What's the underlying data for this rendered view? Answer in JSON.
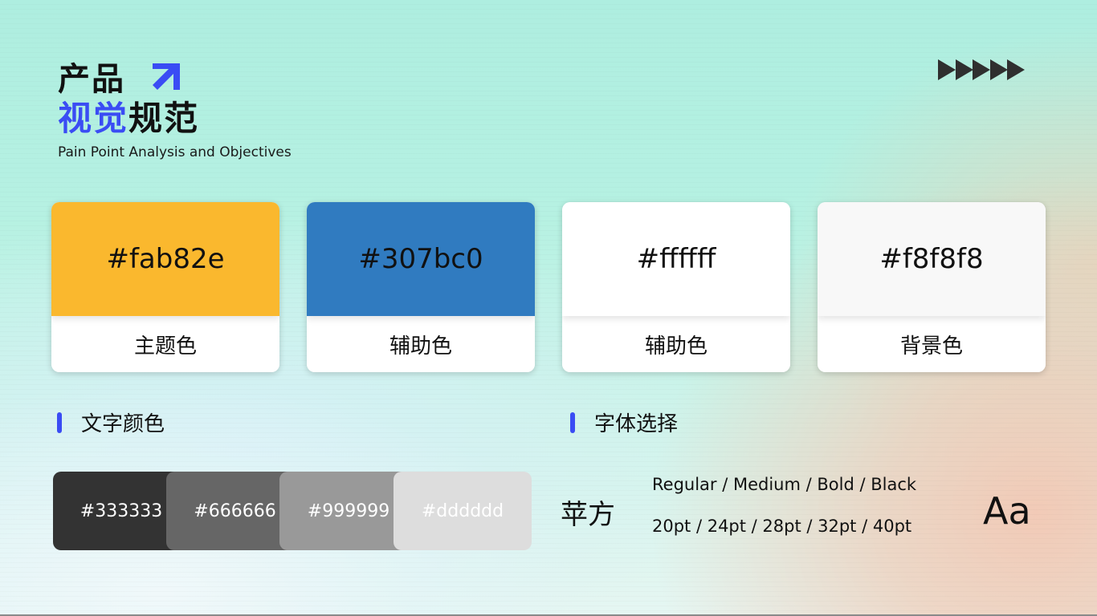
{
  "header": {
    "title_line1": "产品",
    "title_line2_highlight": "视觉",
    "title_line2_rest": "规范",
    "subtitle": "Pain Point Analysis and Objectives",
    "accent_color": "#3a4cf4",
    "arrow_icon": "arrow-up-right-icon",
    "decoration_icon": "chevrons-right-icon"
  },
  "color_cards": [
    {
      "hex": "#fab82e",
      "label": "主题色",
      "swatch_color": "#fab82e"
    },
    {
      "hex": "#307bc0",
      "label": "辅助色",
      "swatch_color": "#307bc0"
    },
    {
      "hex": "#ffffff",
      "label": "辅助色",
      "swatch_color": "#ffffff"
    },
    {
      "hex": "#f8f8f8",
      "label": "背景色",
      "swatch_color": "#f8f8f8"
    }
  ],
  "text_colors": {
    "heading": "文字颜色",
    "swatches": [
      {
        "hex": "#333333",
        "color": "#333333"
      },
      {
        "hex": "#666666",
        "color": "#666666"
      },
      {
        "hex": "#999999",
        "color": "#999999"
      },
      {
        "hex": "#dddddd",
        "color": "#dddddd"
      }
    ]
  },
  "font_selection": {
    "heading": "字体选择",
    "font_name": "苹方",
    "weights": "Regular / Medium / Bold / Black",
    "sizes": "20pt / 24pt / 28pt / 32pt / 40pt",
    "sample": "Aa"
  }
}
